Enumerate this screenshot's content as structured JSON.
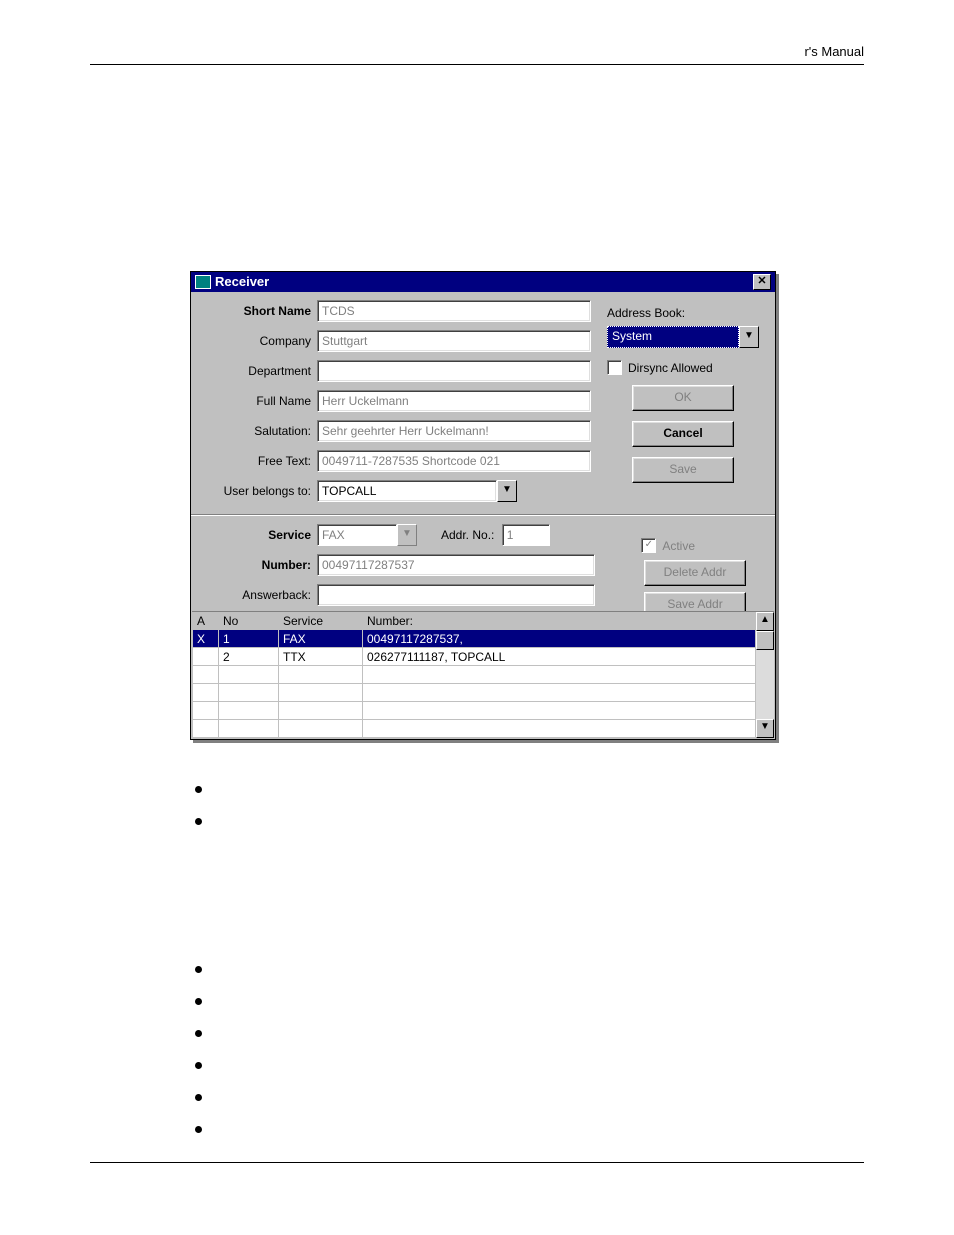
{
  "header_right": "r's Manual",
  "dialog": {
    "title": "Receiver",
    "labels": {
      "short_name": "Short Name",
      "company": "Company",
      "department": "Department",
      "full_name": "Full Name",
      "salutation": "Salutation:",
      "free_text": "Free Text:",
      "user_belongs_to": "User belongs to:",
      "address_book": "Address Book:",
      "dirsync": "Dirsync Allowed",
      "service": "Service",
      "addr_no": "Addr. No.:",
      "active": "Active",
      "number": "Number:",
      "answerback": "Answerback:"
    },
    "values": {
      "short_name": "TCDS",
      "company": "Stuttgart",
      "department": "",
      "full_name": "Herr Uckelmann",
      "salutation": "Sehr geehrter Herr Uckelmann!",
      "free_text": "0049711-7287535    Shortcode 021",
      "user_belongs_to": "TOPCALL",
      "address_book": "System",
      "service": "FAX",
      "addr_no": "1",
      "number": "00497117287537",
      "answerback": ""
    },
    "buttons": {
      "ok": "OK",
      "cancel": "Cancel",
      "save": "Save",
      "delete_addr": "Delete Addr",
      "save_addr": "Save Addr"
    },
    "table": {
      "headers": {
        "a": "A",
        "no": "No",
        "service": "Service",
        "number": "Number:"
      },
      "rows": [
        {
          "a": "X",
          "no": "1",
          "service": "FAX",
          "number": "00497117287537,",
          "selected": true
        },
        {
          "a": "",
          "no": "2",
          "service": "TTX",
          "number": "026277111187, TOPCALL",
          "selected": false
        },
        {
          "a": "",
          "no": "",
          "service": "",
          "number": "",
          "selected": false
        },
        {
          "a": "",
          "no": "",
          "service": "",
          "number": "",
          "selected": false
        },
        {
          "a": "",
          "no": "",
          "service": "",
          "number": "",
          "selected": false
        },
        {
          "a": "",
          "no": "",
          "service": "",
          "number": "",
          "selected": false
        }
      ]
    }
  }
}
